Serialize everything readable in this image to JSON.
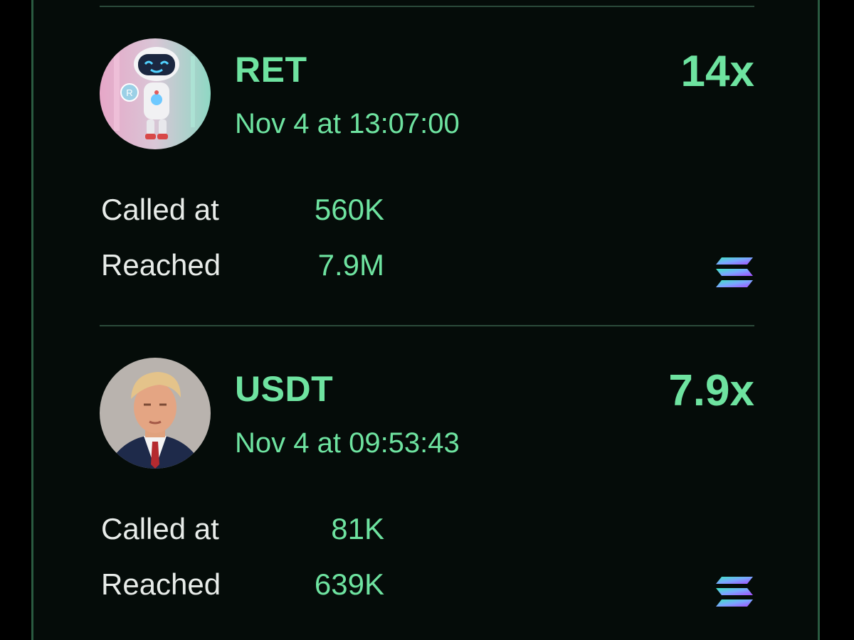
{
  "calls": [
    {
      "ticker": "RET",
      "datetime": "Nov 4 at 13:07:00",
      "multiplier": "14x",
      "called_at_label": "Called at",
      "called_at_value": "560K",
      "reached_label": "Reached",
      "reached_value": "7.9M",
      "avatar_icon": "robot-avatar-icon",
      "chain_icon": "solana-icon"
    },
    {
      "ticker": "USDT",
      "datetime": "Nov 4 at 09:53:43",
      "multiplier": "7.9x",
      "called_at_label": "Called at",
      "called_at_value": "81K",
      "reached_label": "Reached",
      "reached_value": "639K",
      "avatar_icon": "portrait-avatar-icon",
      "chain_icon": "solana-icon"
    }
  ],
  "colors": {
    "background": "#050c09",
    "accent_green": "#6ee3a0",
    "label_white": "#e8ece9",
    "divider": "#2b4a3a",
    "panel_border": "#2a5a40"
  }
}
